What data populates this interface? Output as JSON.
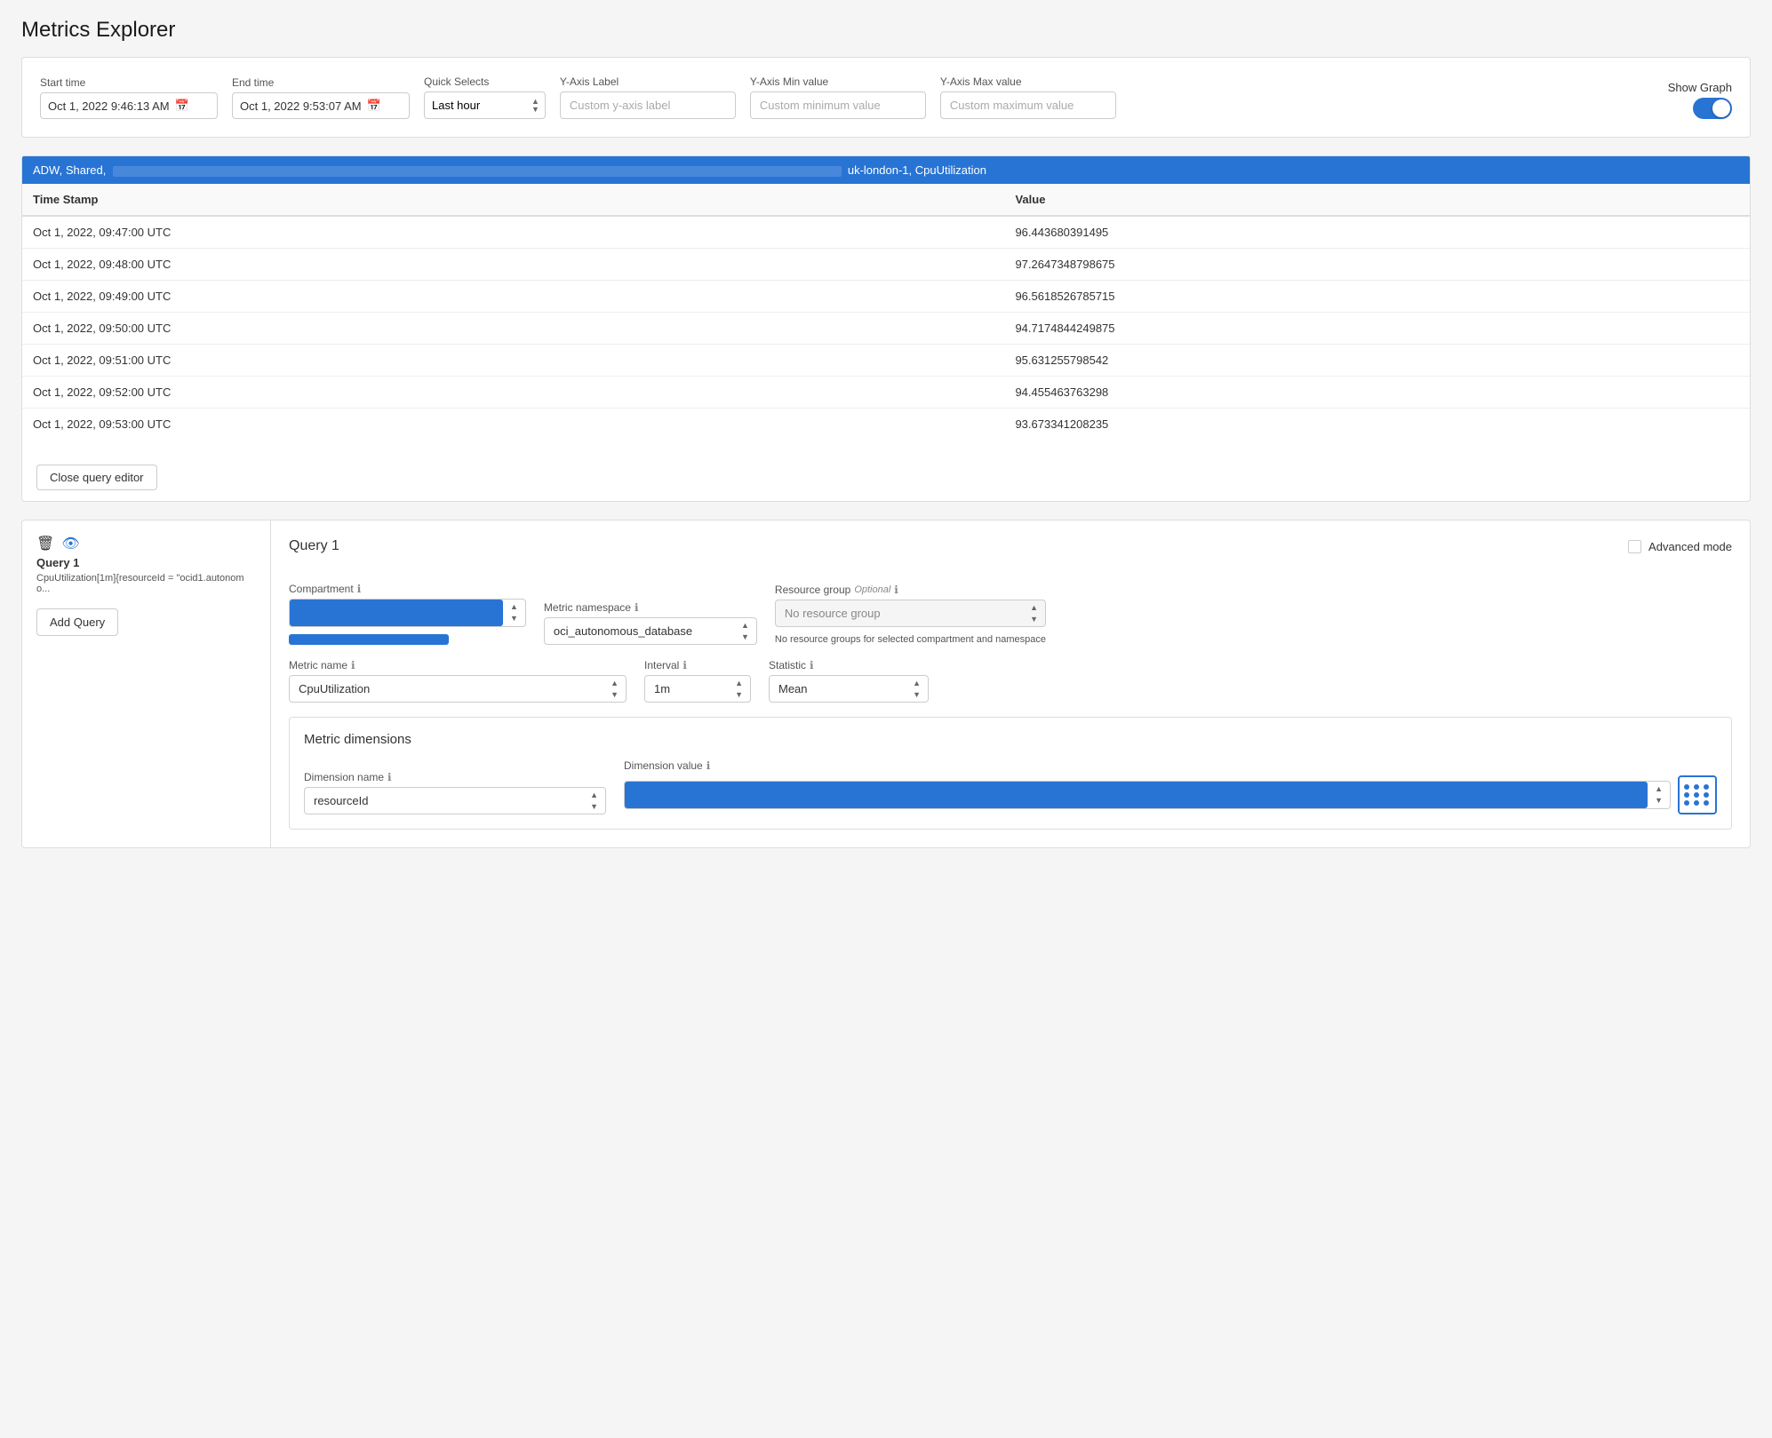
{
  "page": {
    "title": "Metrics Explorer"
  },
  "header": {
    "start_time_label": "Start time",
    "start_time_value": "Oct 1, 2022 9:46:13 AM",
    "end_time_label": "End time",
    "end_time_value": "Oct 1, 2022 9:53:07 AM",
    "quick_selects_label": "Quick Selects",
    "quick_selects_value": "Last hour",
    "yaxis_label_label": "Y-Axis Label",
    "yaxis_label_placeholder": "Custom y-axis label",
    "yaxis_min_label": "Y-Axis Min value",
    "yaxis_min_placeholder": "Custom minimum value",
    "yaxis_max_label": "Y-Axis Max value",
    "yaxis_max_placeholder": "Custom maximum value",
    "show_graph_label": "Show Graph"
  },
  "results": {
    "header_text": "ADW, Shared, CpuUtilization",
    "region_text": "uk-london-1, CpuUtilization",
    "col_timestamp": "Time Stamp",
    "col_value": "Value",
    "rows": [
      {
        "timestamp": "Oct 1, 2022, 09:47:00 UTC",
        "value": "96.443680391495"
      },
      {
        "timestamp": "Oct 1, 2022, 09:48:00 UTC",
        "value": "97.2647348798675"
      },
      {
        "timestamp": "Oct 1, 2022, 09:49:00 UTC",
        "value": "96.5618526785715"
      },
      {
        "timestamp": "Oct 1, 2022, 09:50:00 UTC",
        "value": "94.7174844249875"
      },
      {
        "timestamp": "Oct 1, 2022, 09:51:00 UTC",
        "value": "95.631255798542"
      },
      {
        "timestamp": "Oct 1, 2022, 09:52:00 UTC",
        "value": "94.455463763298"
      },
      {
        "timestamp": "Oct 1, 2022, 09:53:00 UTC",
        "value": "93.673341208235"
      }
    ],
    "close_query_btn": "Close query editor"
  },
  "query_panel": {
    "left": {
      "title": "Query 1",
      "subtitle": "CpuUtilization[1m]{resourceId = \"ocid1.autonomo...",
      "add_query_btn": "Add Query"
    },
    "right": {
      "title": "Query 1",
      "advanced_mode_label": "Advanced mode",
      "compartment_label": "Compartment",
      "metric_namespace_label": "Metric namespace",
      "metric_namespace_value": "oci_autonomous_database",
      "resource_group_label": "Resource group",
      "resource_group_optional": "Optional",
      "resource_group_placeholder": "No resource group",
      "resource_group_note": "No resource groups for selected compartment and namespace",
      "metric_name_label": "Metric name",
      "metric_name_value": "CpuUtilization",
      "interval_label": "Interval",
      "interval_value": "1m",
      "statistic_label": "Statistic",
      "statistic_value": "Mean",
      "dimensions": {
        "title": "Metric dimensions",
        "dim_name_label": "Dimension name",
        "dim_value_label": "Dimension value",
        "dim_name_value": "resourceId"
      }
    }
  },
  "icons": {
    "calendar": "📅",
    "info": "ℹ",
    "trash": "🗑",
    "eye": "👁",
    "chevron_up": "▲",
    "chevron_down": "▼"
  }
}
